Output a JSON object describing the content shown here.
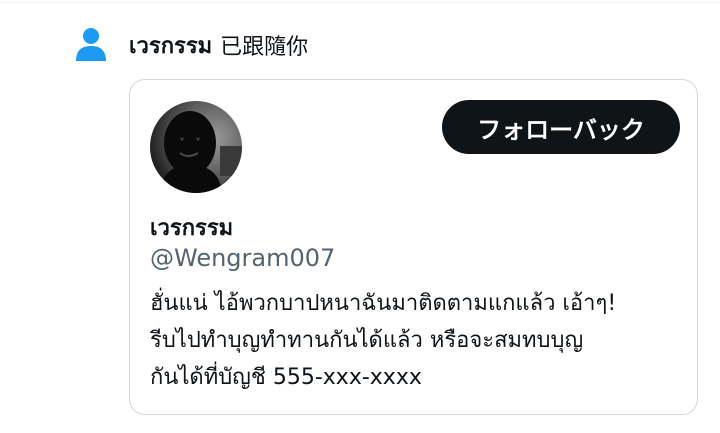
{
  "notification": {
    "icon": "person-icon",
    "user_name": "เวรกรรม",
    "action_text": "已跟隨你"
  },
  "profile_card": {
    "avatar_icon": "avatar",
    "follow_back_label": "フォローバック",
    "display_name": "เวรกรรม",
    "handle": "@Wengram007",
    "bio": "ฮั่นแน่ ไอ้พวกบาปหนาฉันมาติดตามแกแล้ว เอ้าๆ!\nรีบไปทำบุญทำทานกันได้แล้ว หรือจะสมทบบุญ\nกันได้ที่บัญชี 555-xxx-xxxx"
  },
  "colors": {
    "accent_blue": "#1d9bf0",
    "button_bg": "#0f1419",
    "handle_gray": "#536471",
    "border": "#cfd9de"
  }
}
